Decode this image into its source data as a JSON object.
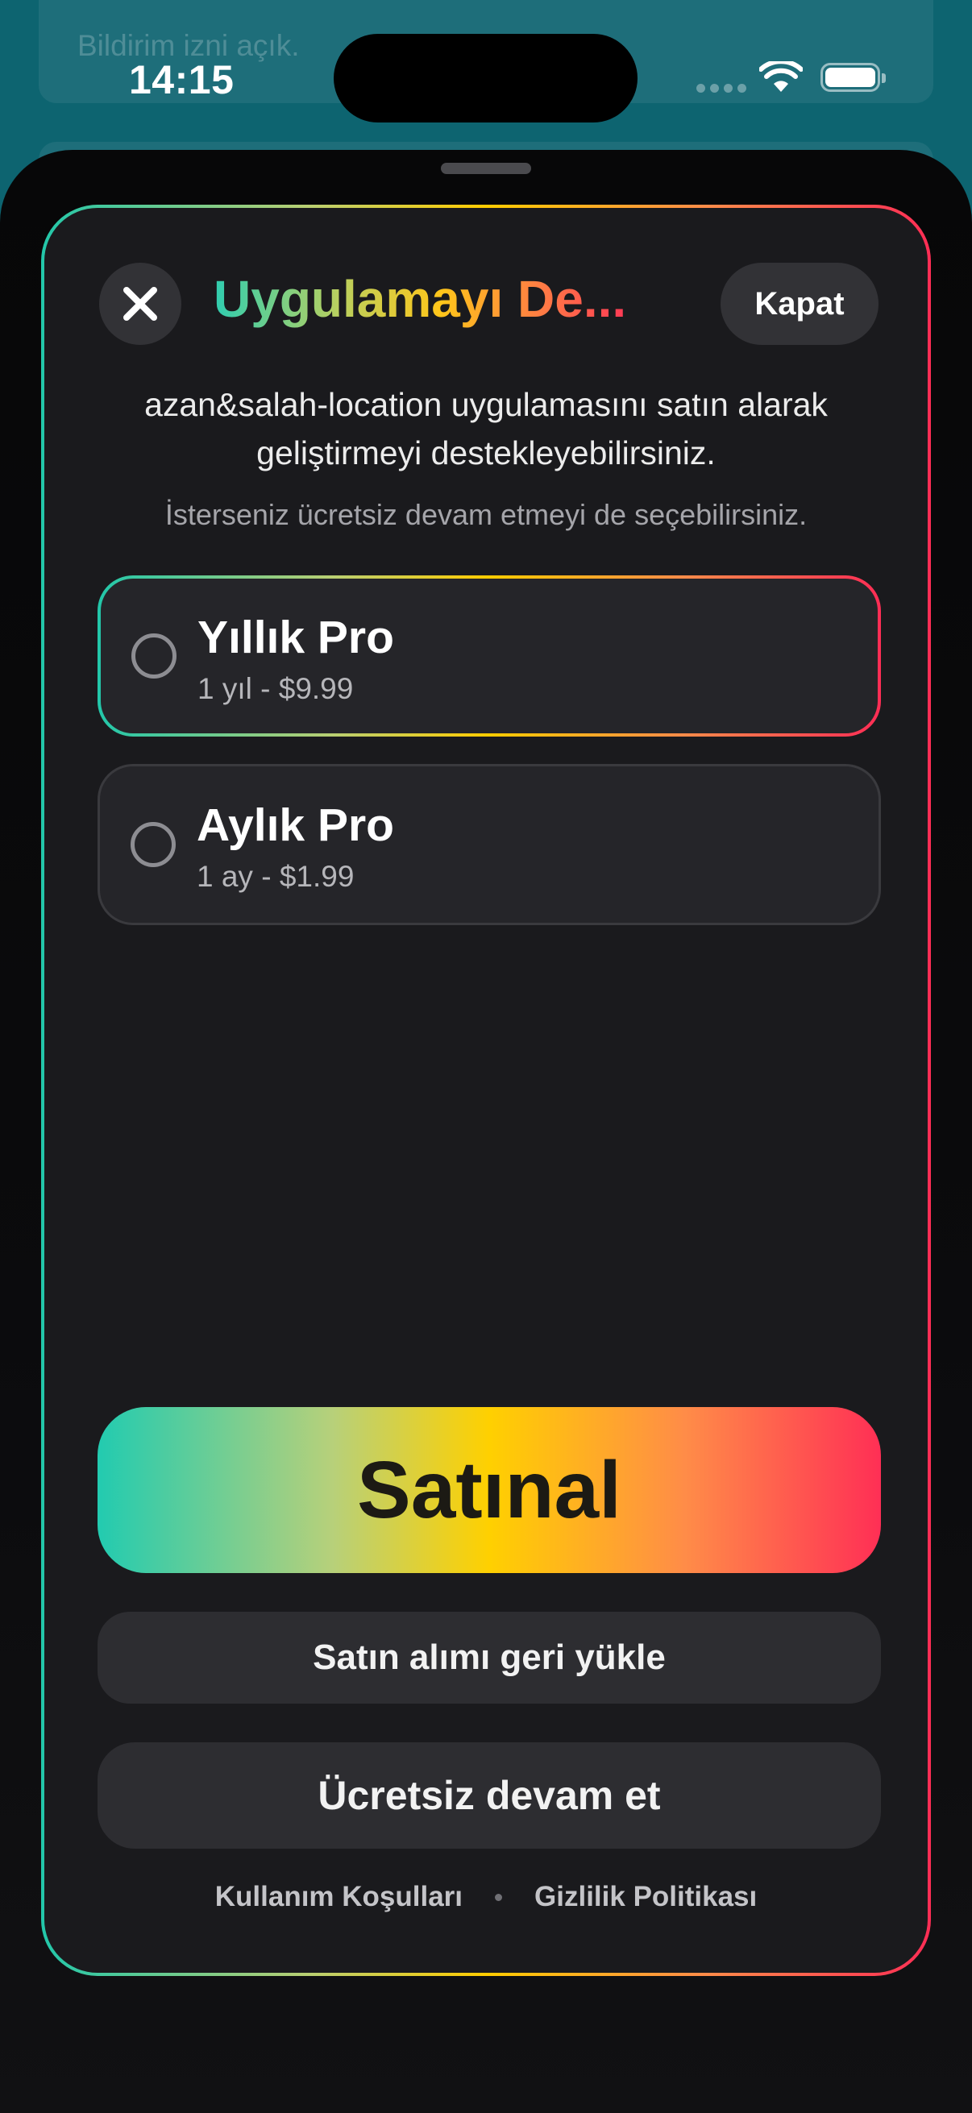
{
  "status_bar": {
    "time": "14:15"
  },
  "background_app": {
    "notification_text": "Bildirim izni açık."
  },
  "paywall": {
    "title": "Uygulamayı De...",
    "close_label": "Kapat",
    "subtitle": "azan&salah-location uygulamasını satın alarak geliştirmeyi destekleyebilirsiniz.",
    "note": "İsterseniz ücretsiz devam etmeyi de seçebilirsiniz.",
    "options": [
      {
        "title": "Yıllık Pro",
        "price": "1 yıl - $9.99",
        "selected": false
      },
      {
        "title": "Aylık Pro",
        "price": "1 ay - $1.99",
        "selected": false
      }
    ],
    "buy_label": "Satınal",
    "restore_label": "Satın alımı geri yükle",
    "continue_free_label": "Ücretsiz devam et",
    "footer": {
      "terms": "Kullanım Koşulları",
      "privacy": "Gizlilik Politikası"
    },
    "accent_gradient": [
      "#22c7aa",
      "#ffcc00",
      "#ff2d55"
    ]
  }
}
